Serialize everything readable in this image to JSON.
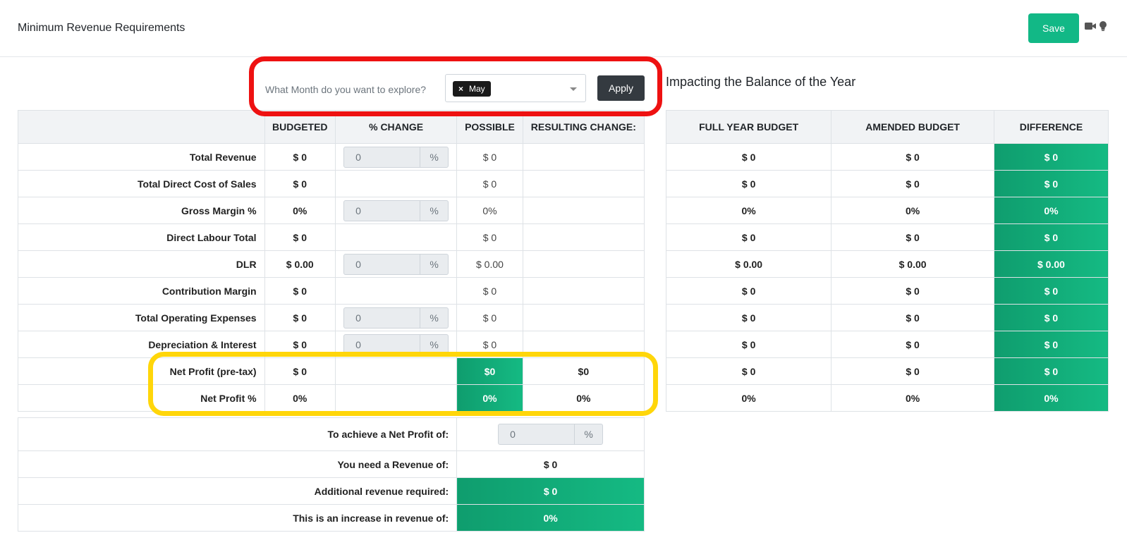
{
  "header": {
    "title": "Minimum Revenue Requirements",
    "save_label": "Save",
    "icons": [
      "video-camera-icon",
      "lightbulb-icon"
    ]
  },
  "filter": {
    "label": "What Month do you want to explore?",
    "selected_month": "May",
    "tag_remove": "×",
    "apply_label": "Apply"
  },
  "balance_title": "Impacting the Balance of the Year",
  "main_table": {
    "headers": [
      "",
      "BUDGETED",
      "% CHANGE",
      "POSSIBLE",
      "RESULTING CHANGE:"
    ],
    "rows": [
      {
        "label": "Total Revenue",
        "budgeted": "$ 0",
        "change": "0",
        "possible": "$ 0",
        "result": ""
      },
      {
        "label": "Total Direct Cost of Sales",
        "budgeted": "$ 0",
        "change": null,
        "possible": "$ 0",
        "result": ""
      },
      {
        "label": "Gross Margin %",
        "budgeted": "0%",
        "change": "0",
        "possible": "0%",
        "result": ""
      },
      {
        "label": "Direct Labour Total",
        "budgeted": "$ 0",
        "change": null,
        "possible": "$ 0",
        "result": ""
      },
      {
        "label": "DLR",
        "budgeted": "$ 0.00",
        "change": "0",
        "possible": "$ 0.00",
        "result": ""
      },
      {
        "label": "Contribution Margin",
        "budgeted": "$ 0",
        "change": null,
        "possible": "$ 0",
        "result": ""
      },
      {
        "label": "Total Operating Expenses",
        "budgeted": "$ 0",
        "change": "0",
        "possible": "$ 0",
        "result": ""
      },
      {
        "label": "Depreciation & Interest",
        "budgeted": "$ 0",
        "change": "0",
        "possible": "$ 0",
        "result": ""
      },
      {
        "label": "Net Profit (pre-tax)",
        "budgeted": "$ 0",
        "change": null,
        "possible": "$0",
        "result": "$0"
      },
      {
        "label": "Net Profit %",
        "budgeted": "0%",
        "change": null,
        "possible": "0%",
        "result": "0%"
      }
    ],
    "pct_sign": "%"
  },
  "right_table": {
    "headers": [
      "FULL YEAR BUDGET",
      "AMENDED BUDGET",
      "DIFFERENCE"
    ],
    "rows": [
      [
        "$ 0",
        "$ 0",
        "$ 0"
      ],
      [
        "$ 0",
        "$ 0",
        "$ 0"
      ],
      [
        "0%",
        "0%",
        "0%"
      ],
      [
        "$ 0",
        "$ 0",
        "$ 0"
      ],
      [
        "$ 0.00",
        "$ 0.00",
        "$ 0.00"
      ],
      [
        "$ 0",
        "$ 0",
        "$ 0"
      ],
      [
        "$ 0",
        "$ 0",
        "$ 0"
      ],
      [
        "$ 0",
        "$ 0",
        "$ 0"
      ],
      [
        "$ 0",
        "$ 0",
        "$ 0"
      ],
      [
        "0%",
        "0%",
        "0%"
      ]
    ]
  },
  "bottom_table": {
    "target_label": "To achieve a Net Profit of:",
    "target_value": "0",
    "target_sign": "%",
    "revenue_label": "You need a Revenue of:",
    "revenue_value": "$ 0",
    "additional_label": "Additional revenue required:",
    "additional_value": "$ 0",
    "increase_label": "This is an increase in revenue of:",
    "increase_value": "0%"
  },
  "colors": {
    "accent_green": "#12b886",
    "annotation_red": "#ee1111",
    "annotation_yellow": "#ffd60a"
  }
}
